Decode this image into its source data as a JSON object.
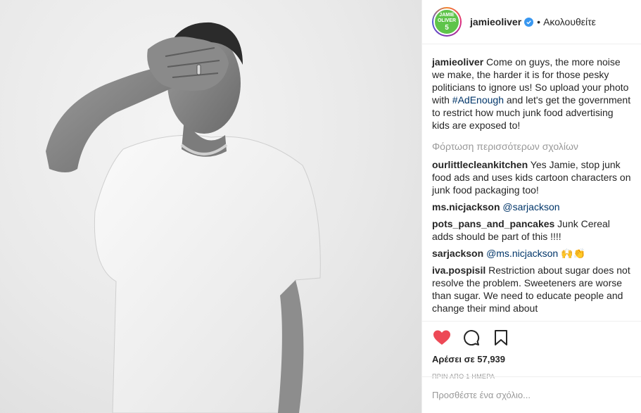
{
  "header": {
    "username": "jamieoliver",
    "separator": "•",
    "follow_status": "Ακολουθείτε",
    "avatar": {
      "line1": "JAMIE",
      "line2": "OLIVER",
      "line3": "5",
      "color": "#5ec44a"
    },
    "verified_color": "#3897f0"
  },
  "caption": {
    "username": "jamieoliver",
    "text_before": " Come on guys, the more noise we make, the harder it is for those pesky politicians to ignore us! So upload your photo with ",
    "hashtag": "#AdEnough",
    "text_after": " and let's get the government to restrict how much junk food advertising kids are exposed to!"
  },
  "load_more": "Φόρτωση περισσότερων σχολίων",
  "comments": [
    {
      "username": "ourlittlecleankitchen",
      "text": " Yes Jamie, stop junk food ads and uses kids cartoon characters on junk food packaging too!",
      "mention": "",
      "after": ""
    },
    {
      "username": "ms.nicjackson",
      "text": " ",
      "mention": "@sarjackson",
      "after": ""
    },
    {
      "username": "pots_pans_and_pancakes",
      "text": " Junk Cereal adds should be part of this !!!!",
      "mention": "",
      "after": ""
    },
    {
      "username": "sarjackson",
      "text": " ",
      "mention": "@ms.nicjackson",
      "after": " 🙌👏"
    },
    {
      "username": "iva.pospisil",
      "text": " Restriction about sugar does not resolve the problem. Sweeteners are worse than sugar. We need to educate people and change their mind about",
      "mention": "",
      "after": ""
    }
  ],
  "actions": {
    "like_icon": "heart-icon",
    "comment_icon": "comment-bubble-icon",
    "save_icon": "bookmark-icon",
    "like_color": "#ed4956"
  },
  "likes": "Αρέσει σε 57,939",
  "timestamp": "ΠΡΙΝ ΑΠΟ 1 ΗΜΕΡΑ",
  "add_comment_placeholder": "Προσθέστε ένα σχόλιο..."
}
